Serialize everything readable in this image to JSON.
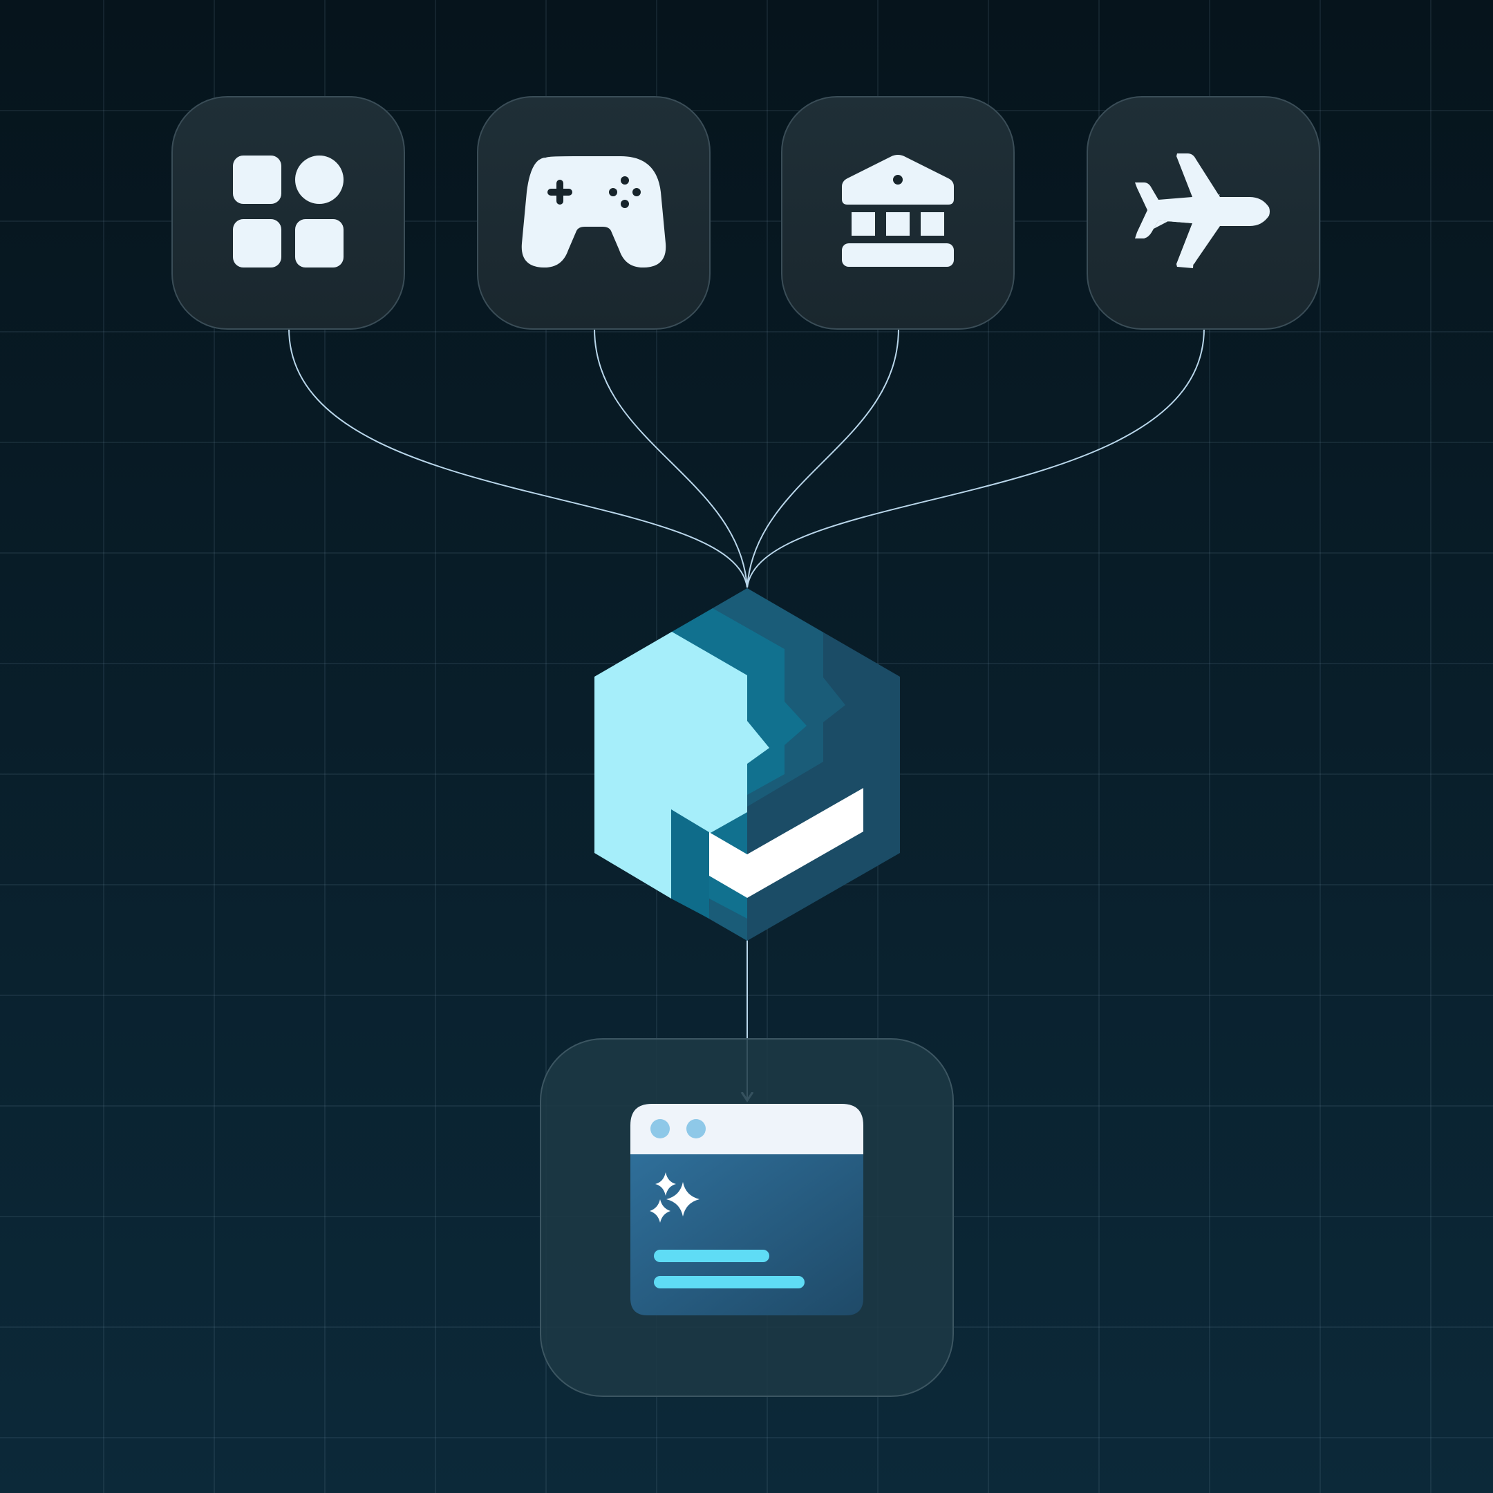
{
  "colors": {
    "background_top": "#06141c",
    "background_bottom": "#0c2939",
    "grid_line": "#8fb3c4",
    "tile_fill": "#1c2b33",
    "tile_border": "#3a4d57",
    "icon_fill": "#eaf4fb",
    "connector": "#b9d6ea",
    "hex_light": "#a6eefa",
    "hex_mid": "#11718f",
    "hex_dark": "#1b4c66",
    "hex_accent": "#ffffff",
    "window_titlebar": "#eff4fa",
    "window_dot": "#8ec8e8",
    "window_body": "#2a5f85",
    "window_lines": "#5fdcf5",
    "output_tile_fill": "#1d3945"
  },
  "sources": [
    {
      "icon": "apps-icon"
    },
    {
      "icon": "gamepad-icon"
    },
    {
      "icon": "bank-icon"
    },
    {
      "icon": "airplane-icon"
    }
  ],
  "hub": {
    "icon": "hexagon-check-logo"
  },
  "output": {
    "icon": "browser-window-sparkles-icon"
  }
}
